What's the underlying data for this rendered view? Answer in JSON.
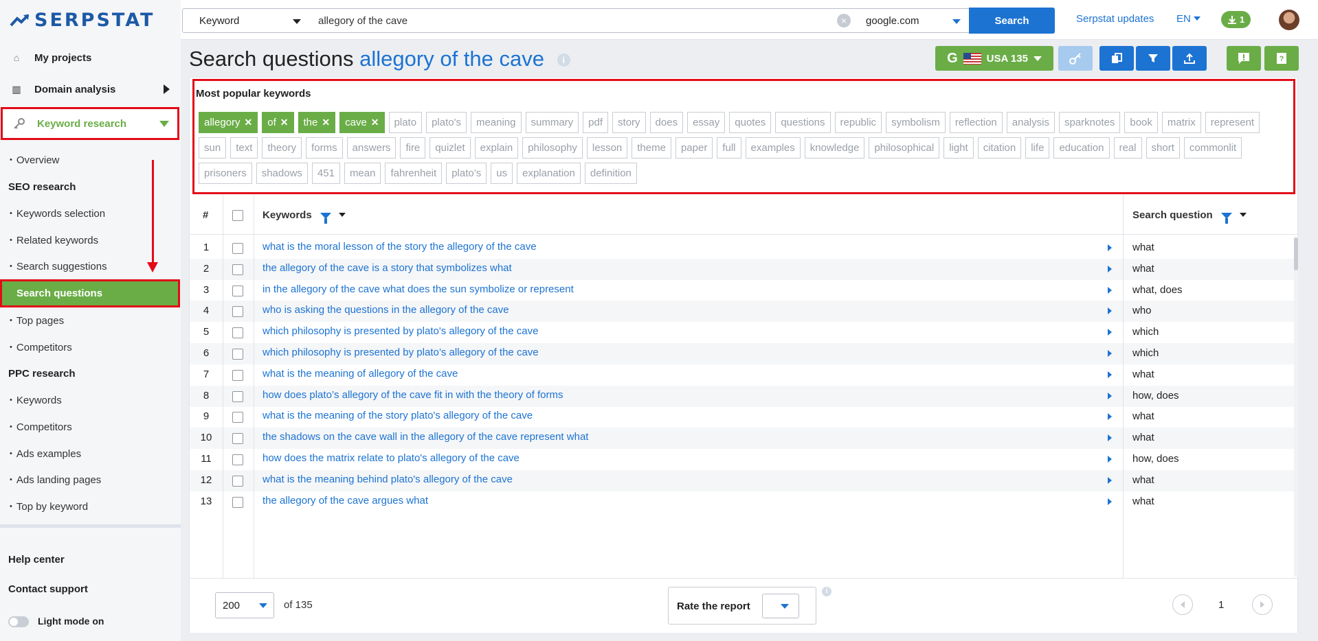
{
  "logo": {
    "text": "SERPSTAT"
  },
  "sidebar": {
    "main_items": [
      {
        "label": "My projects",
        "icon": "home-icon"
      },
      {
        "label": "Domain analysis",
        "icon": "chart-icon"
      },
      {
        "label": "Keyword research",
        "icon": "key-icon"
      }
    ],
    "overview": "Overview",
    "seo_section": "SEO research",
    "seo_items": [
      "Keywords selection",
      "Related keywords",
      "Search suggestions",
      "Search questions",
      "Top pages",
      "Competitors"
    ],
    "ppc_section": "PPC research",
    "ppc_items": [
      "Keywords",
      "Competitors",
      "Ads examples",
      "Ads landing pages",
      "Top by keyword"
    ],
    "help_center": "Help center",
    "contact_support": "Contact support",
    "light_mode": "Light mode on"
  },
  "topbar": {
    "search_type": "Keyword",
    "search_value": "allegory of the cave",
    "domain": "google.com",
    "search_button": "Search",
    "updates": "Serpstat updates",
    "lang": "EN",
    "downloads_count": "1"
  },
  "page": {
    "title_prefix": "Search questions",
    "title_keyword": "allegory of the cave",
    "info": "i",
    "db_label": "USA 135",
    "g_letter": "G"
  },
  "popular": {
    "title": "Most popular keywords",
    "active_chips": [
      "allegory",
      "of",
      "the",
      "cave"
    ],
    "chips": [
      "plato",
      "plato's",
      "meaning",
      "summary",
      "pdf",
      "story",
      "does",
      "essay",
      "quotes",
      "questions",
      "republic",
      "symbolism",
      "reflection",
      "analysis",
      "sparknotes",
      "book",
      "matrix",
      "represent",
      "sun",
      "text",
      "theory",
      "forms",
      "answers",
      "fire",
      "quizlet",
      "explain",
      "philosophy",
      "lesson",
      "theme",
      "paper",
      "full",
      "examples",
      "knowledge",
      "philosophical",
      "light",
      "citation",
      "life",
      "education",
      "real",
      "short",
      "commonlit",
      "prisoners",
      "shadows",
      "451",
      "mean",
      "fahrenheit",
      "plato’s",
      "us",
      "explanation",
      "definition"
    ]
  },
  "table": {
    "col_num": "#",
    "col_keywords": "Keywords",
    "col_question": "Search question",
    "rows": [
      {
        "n": "1",
        "kw": "what is the moral lesson of the story the allegory of the cave",
        "q": "what"
      },
      {
        "n": "2",
        "kw": "the allegory of the cave is a story that symbolizes what",
        "q": "what"
      },
      {
        "n": "3",
        "kw": "in the allegory of the cave what does the sun symbolize or represent",
        "q": "what, does"
      },
      {
        "n": "4",
        "kw": "who is asking the questions in the allegory of the cave",
        "q": "who"
      },
      {
        "n": "5",
        "kw": "which philosophy is presented by plato's allegory of the cave",
        "q": "which"
      },
      {
        "n": "6",
        "kw": "which philosophy is presented by plato’s allegory of the cave",
        "q": "which"
      },
      {
        "n": "7",
        "kw": "what is the meaning of allegory of the cave",
        "q": "what"
      },
      {
        "n": "8",
        "kw": "how does plato’s allegory of the cave fit in with the theory of forms",
        "q": "how, does"
      },
      {
        "n": "9",
        "kw": "what is the meaning of the story plato's allegory of the cave",
        "q": "what"
      },
      {
        "n": "10",
        "kw": "the shadows on the cave wall in the allegory of the cave represent what",
        "q": "what"
      },
      {
        "n": "11",
        "kw": "how does the matrix relate to plato's allegory of the cave",
        "q": "how, does"
      },
      {
        "n": "12",
        "kw": "what is the meaning behind plato's allegory of the cave",
        "q": "what"
      },
      {
        "n": "13",
        "kw": "the allegory of the cave argues what",
        "q": "what"
      }
    ]
  },
  "footer": {
    "per_page": "200",
    "of_total": "of 135",
    "rate_label": "Rate the report",
    "page_number": "1"
  },
  "colors": {
    "brand_blue": "#1c73d2",
    "brand_green": "#6aad47",
    "highlight_red": "#e30b17"
  }
}
